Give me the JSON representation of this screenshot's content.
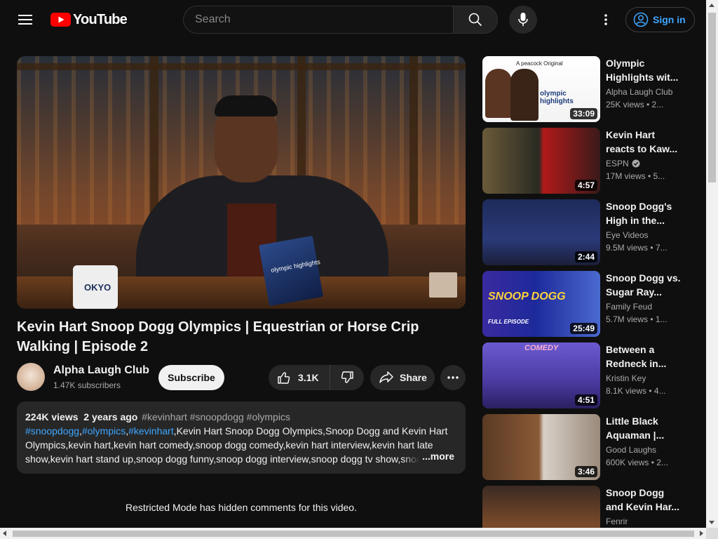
{
  "header": {
    "logo_text": "YouTube",
    "search_placeholder": "Search",
    "signin_label": "Sign in"
  },
  "video": {
    "title": "Kevin Hart Snoop Dogg Olympics | Equestrian or Horse Crip Walking | Episode 2",
    "player_mug_text": "OKYO",
    "player_book_text": "olympic highlights"
  },
  "channel": {
    "name": "Alpha Laugh Club",
    "subscribers": "1.47K subscribers",
    "subscribe_label": "Subscribe"
  },
  "actions": {
    "like_count": "3.1K",
    "share_label": "Share"
  },
  "description": {
    "views": "224K views",
    "age": "2 years ago",
    "hashtags": "#kevinhart #snoopdogg #olympics",
    "links": [
      "#snoopdogg",
      "#olympics",
      "#kevinhart"
    ],
    "text": "Kevin Hart Snoop Dogg Olympics,Snoop Dogg and Kevin Hart Olympics,kevin hart,kevin hart comedy,snoop dogg comedy,kevin hart interview,kevin hart late show,kevin hart stand up,snoop dogg funny,snoop dogg interview,snoop dogg tv show,snoo",
    "more_label": "...more"
  },
  "comments": {
    "restricted_notice": "Restricted Mode has hidden comments for this video."
  },
  "recommendations": [
    {
      "title": "Olympic Highlights wit...",
      "channel": "Alpha Laugh Club",
      "meta": "25K views  • 2...",
      "duration": "33:09",
      "verified": false,
      "thumb_text_1": "A peacock Original",
      "thumb_text_2": "olympic highlights"
    },
    {
      "title": "Kevin Hart reacts to Kaw...",
      "channel": "ESPN",
      "meta": "17M views  • 5...",
      "duration": "4:57",
      "verified": true
    },
    {
      "title": "Snoop Dogg's High in the...",
      "channel": "Eye Videos",
      "meta": "9.5M views  • 7...",
      "duration": "2:44",
      "verified": false
    },
    {
      "title": "Snoop Dogg vs. Sugar Ray...",
      "channel": "Family Feud",
      "meta": "5.7M views  • 1...",
      "duration": "25:49",
      "verified": false,
      "thumb_text_1": "SNOOP DOGG",
      "thumb_text_2": "FULL EPISODE"
    },
    {
      "title": "Between a Redneck in...",
      "channel": "Kristin Key",
      "meta": "8.1K views  • 4...",
      "duration": "4:51",
      "verified": false,
      "thumb_text_1": "COMEDY"
    },
    {
      "title": "Little Black Aquaman |...",
      "channel": "Good Laughs",
      "meta": "600K views  • 2...",
      "duration": "3:46",
      "verified": false
    },
    {
      "title": "Snoop Dogg and Kevin Har...",
      "channel": "Fenrir",
      "meta": "",
      "duration": "",
      "verified": false
    }
  ]
}
